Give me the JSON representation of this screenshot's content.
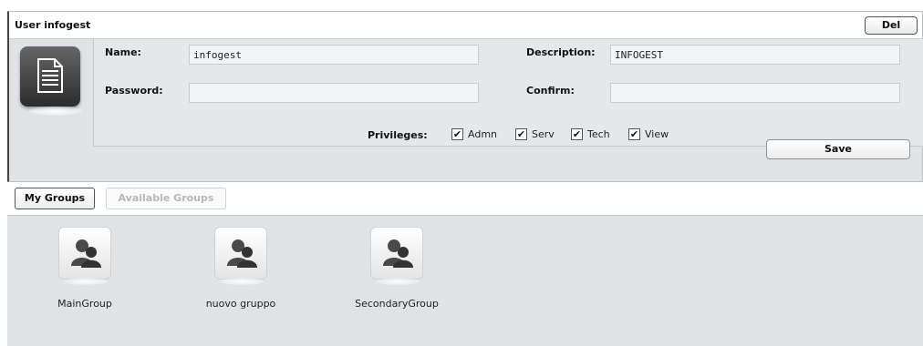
{
  "header": {
    "title": "User infogest",
    "del_label": "Del"
  },
  "form": {
    "name_label": "Name:",
    "name_value": "infogest",
    "description_label": "Description:",
    "description_value": "INFOGEST",
    "password_label": "Password:",
    "password_value": "",
    "confirm_label": "Confirm:",
    "confirm_value": "",
    "privileges_label": "Privileges:",
    "privileges": [
      {
        "label": "Admn",
        "checked": true
      },
      {
        "label": "Serv",
        "checked": true
      },
      {
        "label": "Tech",
        "checked": true
      },
      {
        "label": "View",
        "checked": true
      }
    ],
    "save_label": "Save"
  },
  "tabs": [
    {
      "label": "My Groups",
      "active": true
    },
    {
      "label": "Available Groups",
      "active": false
    }
  ],
  "groups": [
    {
      "label": "MainGroup",
      "icon": "group-icon"
    },
    {
      "label": "nuovo gruppo",
      "icon": "group-icon"
    },
    {
      "label": "SecondaryGroup",
      "icon": "group-icon"
    }
  ],
  "icons": {
    "user": "document-icon",
    "check": "checkmark-icon"
  }
}
